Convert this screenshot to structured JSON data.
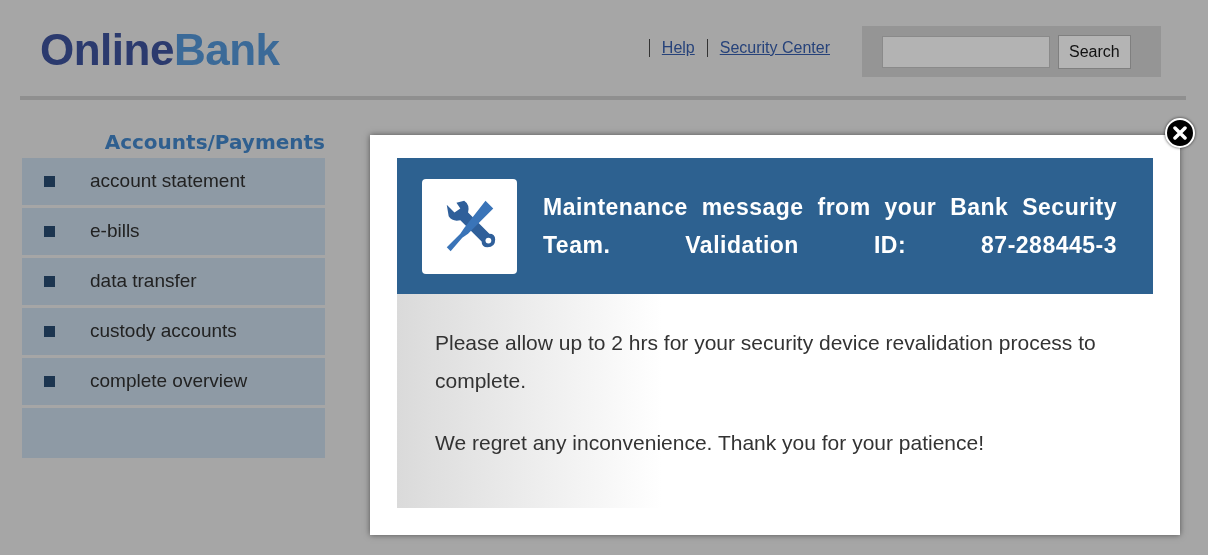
{
  "logo": {
    "first": "Online",
    "second": "Bank"
  },
  "header_links": [
    "Help",
    "Security Center"
  ],
  "search": {
    "button": "Search"
  },
  "sidebar": {
    "title": "Accounts/Payments",
    "items": [
      "account statement",
      "e-bills",
      "data transfer",
      "custody accounts",
      "complete overview"
    ]
  },
  "modal": {
    "title": "Maintenance message from your Bank Security Team. Validation ID: 87-288445-3",
    "paragraphs": [
      "Please allow up to 2 hrs for your security device revalidation process to complete.",
      "We regret any inconvenience. Thank you for your patience!"
    ]
  }
}
